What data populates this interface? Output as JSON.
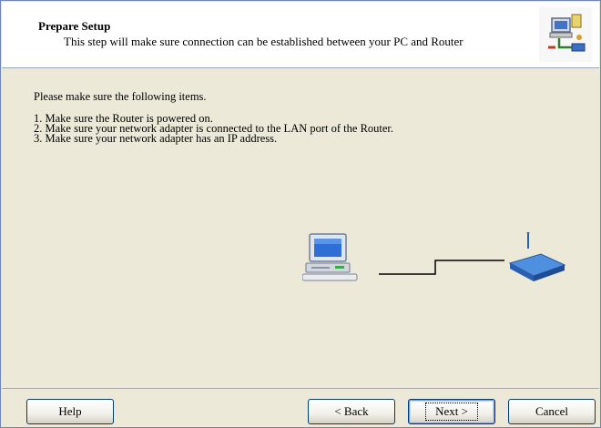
{
  "header": {
    "title": "Prepare Setup",
    "subtitle": "This step will make sure connection can be established between your PC and Router",
    "icon": "network-setup-icon"
  },
  "content": {
    "intro": "Please make sure the following items.",
    "items": [
      "1. Make sure the Router is powered on.",
      "2. Make sure your network adapter is connected to the LAN port of the Router.",
      "3. Make sure your network adapter has an IP address."
    ]
  },
  "diagram": {
    "left_icon": "computer-icon",
    "right_icon": "router-icon"
  },
  "buttons": {
    "help": "Help",
    "back": "< Back",
    "next": "Next >",
    "cancel": "Cancel"
  }
}
